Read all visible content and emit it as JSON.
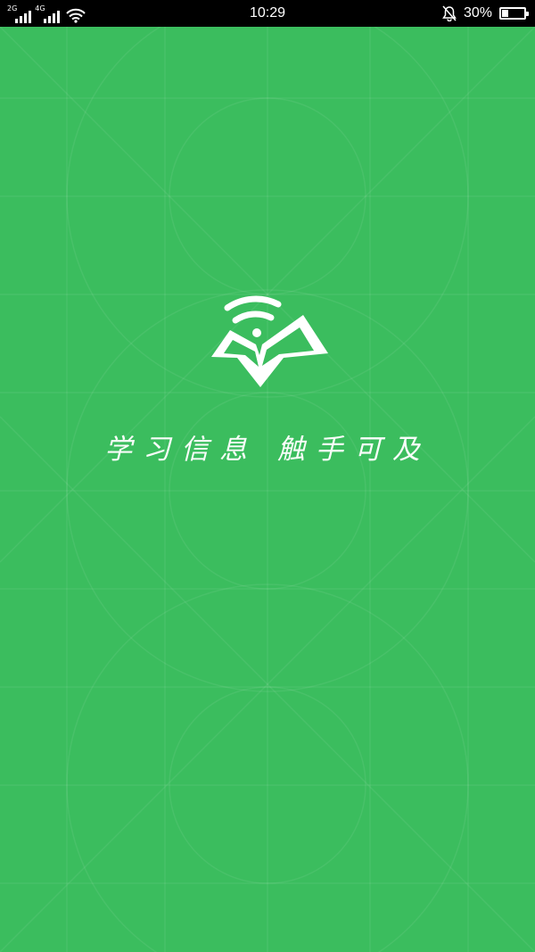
{
  "status_bar": {
    "net_label_1": "2G",
    "net_label_2": "4G",
    "time": "10:29",
    "battery_percent": "30%",
    "battery_level": 0.3,
    "icons": [
      "signal-2g-icon",
      "signal-4g-icon",
      "wifi-icon",
      "bell-muted-icon",
      "battery-icon"
    ]
  },
  "splash": {
    "background_color": "#3bbd5e",
    "logo_icon": "wifi-book-icon",
    "slogan": "学习信息 触手可及"
  }
}
